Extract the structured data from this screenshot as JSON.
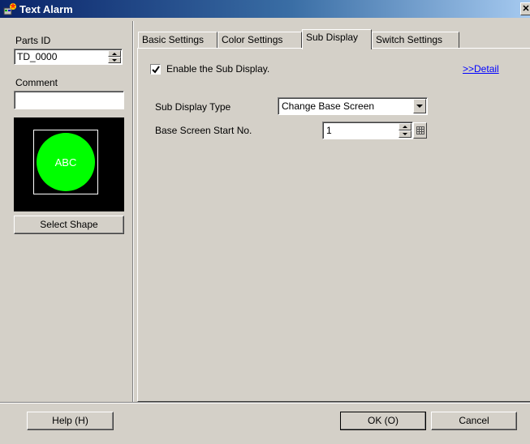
{
  "window": {
    "title": "Text Alarm",
    "close_glyph": "✕"
  },
  "sidebar": {
    "parts_id_label": "Parts ID",
    "parts_id_value": "TD_0000",
    "comment_label": "Comment",
    "comment_value": "",
    "preview_text": "ABC",
    "preview_shape_color": "#00ff00",
    "select_shape_label": "Select Shape"
  },
  "tabs": [
    {
      "label": "Basic Settings",
      "active": false
    },
    {
      "label": "Color Settings",
      "active": false
    },
    {
      "label": "Sub Display",
      "active": true
    },
    {
      "label": "Switch Settings",
      "active": false
    }
  ],
  "sub_display": {
    "enable_label": "Enable the Sub Display.",
    "enable_checked": true,
    "detail_link": ">>Detail",
    "type_label": "Sub Display Type",
    "type_value": "Change Base Screen",
    "start_label": "Base Screen Start No.",
    "start_value": "1"
  },
  "footer": {
    "help_label": "Help (H)",
    "ok_label": "OK (O)",
    "cancel_label": "Cancel"
  }
}
